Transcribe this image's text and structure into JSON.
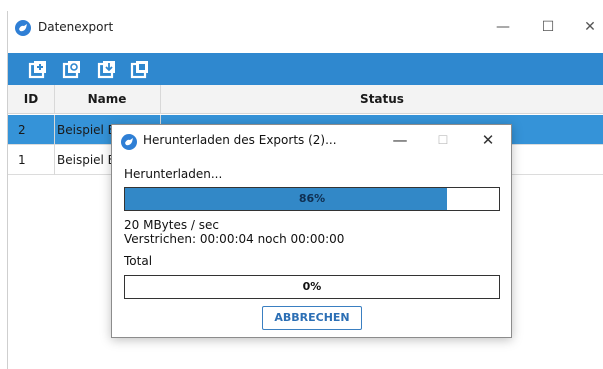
{
  "main_window": {
    "title": "Datenexport",
    "controls": {
      "minimize": "—",
      "maximize": "☐",
      "close": "✕"
    },
    "toolbar": {
      "icons": [
        "add-icon",
        "refresh-icon",
        "download-icon",
        "copy-icon"
      ]
    },
    "table": {
      "columns": [
        "ID",
        "Name",
        "Status"
      ],
      "rows": [
        {
          "id": "2",
          "name": "Beispiel E",
          "selected": true
        },
        {
          "id": "1",
          "name": "Beispiel E",
          "selected": false
        }
      ]
    }
  },
  "dialog": {
    "title": "Herunterladen des Exports (2)...",
    "controls": {
      "minimize": "—",
      "maximize": "☐",
      "close": "✕"
    },
    "status_label": "Herunterladen...",
    "progress": {
      "value": 0.86,
      "text": "86%"
    },
    "speed": "20 MBytes / sec",
    "elapsed": "Verstrichen: 00:00:04 noch 00:00:00",
    "total_label": "Total",
    "total_progress": {
      "value": 0.0,
      "text": "0%"
    },
    "cancel_label": "ABBRECHEN"
  },
  "colors": {
    "accent": "#2f88cf",
    "selected_row": "#3593d8",
    "progress_fill": "#3288c7"
  }
}
